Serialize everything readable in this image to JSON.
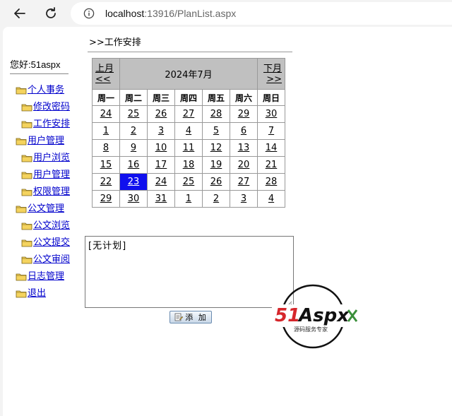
{
  "browser": {
    "url_host": "localhost",
    "url_rest": ":13916/PlanList.aspx",
    "icons": [
      "back-arrow-icon",
      "reload-icon",
      "info-icon"
    ]
  },
  "sidebar": {
    "greeting": "您好:51aspx",
    "items": [
      {
        "label": "个人事务",
        "level": 0
      },
      {
        "label": "修改密码",
        "level": 1
      },
      {
        "label": "工作安排",
        "level": 1
      },
      {
        "label": "用户管理",
        "level": 0
      },
      {
        "label": "用户浏览",
        "level": 1
      },
      {
        "label": "用户管理",
        "level": 1
      },
      {
        "label": "权限管理",
        "level": 1
      },
      {
        "label": "公文管理",
        "level": 0
      },
      {
        "label": "公文浏览",
        "level": 1
      },
      {
        "label": "公文提交",
        "level": 1
      },
      {
        "label": "公文审阅",
        "level": 1
      },
      {
        "label": "日志管理",
        "level": 0
      },
      {
        "label": "退出",
        "level": 0
      }
    ]
  },
  "main": {
    "title": ">>工作安排",
    "calendar": {
      "prev_label_line1": "上月",
      "prev_label_line2": "<<",
      "next_label_line1": "下月",
      "next_label_line2": ">>",
      "title": "2024年7月",
      "weekdays": [
        "周一",
        "周二",
        "周三",
        "周四",
        "周五",
        "周六",
        "周日"
      ],
      "weeks": [
        [
          "24",
          "25",
          "26",
          "27",
          "28",
          "29",
          "30"
        ],
        [
          "1",
          "2",
          "3",
          "4",
          "5",
          "6",
          "7"
        ],
        [
          "8",
          "9",
          "10",
          "11",
          "12",
          "13",
          "14"
        ],
        [
          "15",
          "16",
          "17",
          "18",
          "19",
          "20",
          "21"
        ],
        [
          "22",
          "23",
          "24",
          "25",
          "26",
          "27",
          "28"
        ],
        [
          "29",
          "30",
          "31",
          "1",
          "2",
          "3",
          "4"
        ]
      ],
      "selected_day": "23",
      "selected_color": "#1010ee"
    },
    "plan_text": "[无计划]",
    "add_button_label": "添 加"
  },
  "watermark": {
    "brand_51": "51",
    "brand_aspx": "Aspx",
    "tagline": "源码服务专家",
    "brand_red": "#d6262b",
    "brand_green": "#3a8f3a"
  }
}
